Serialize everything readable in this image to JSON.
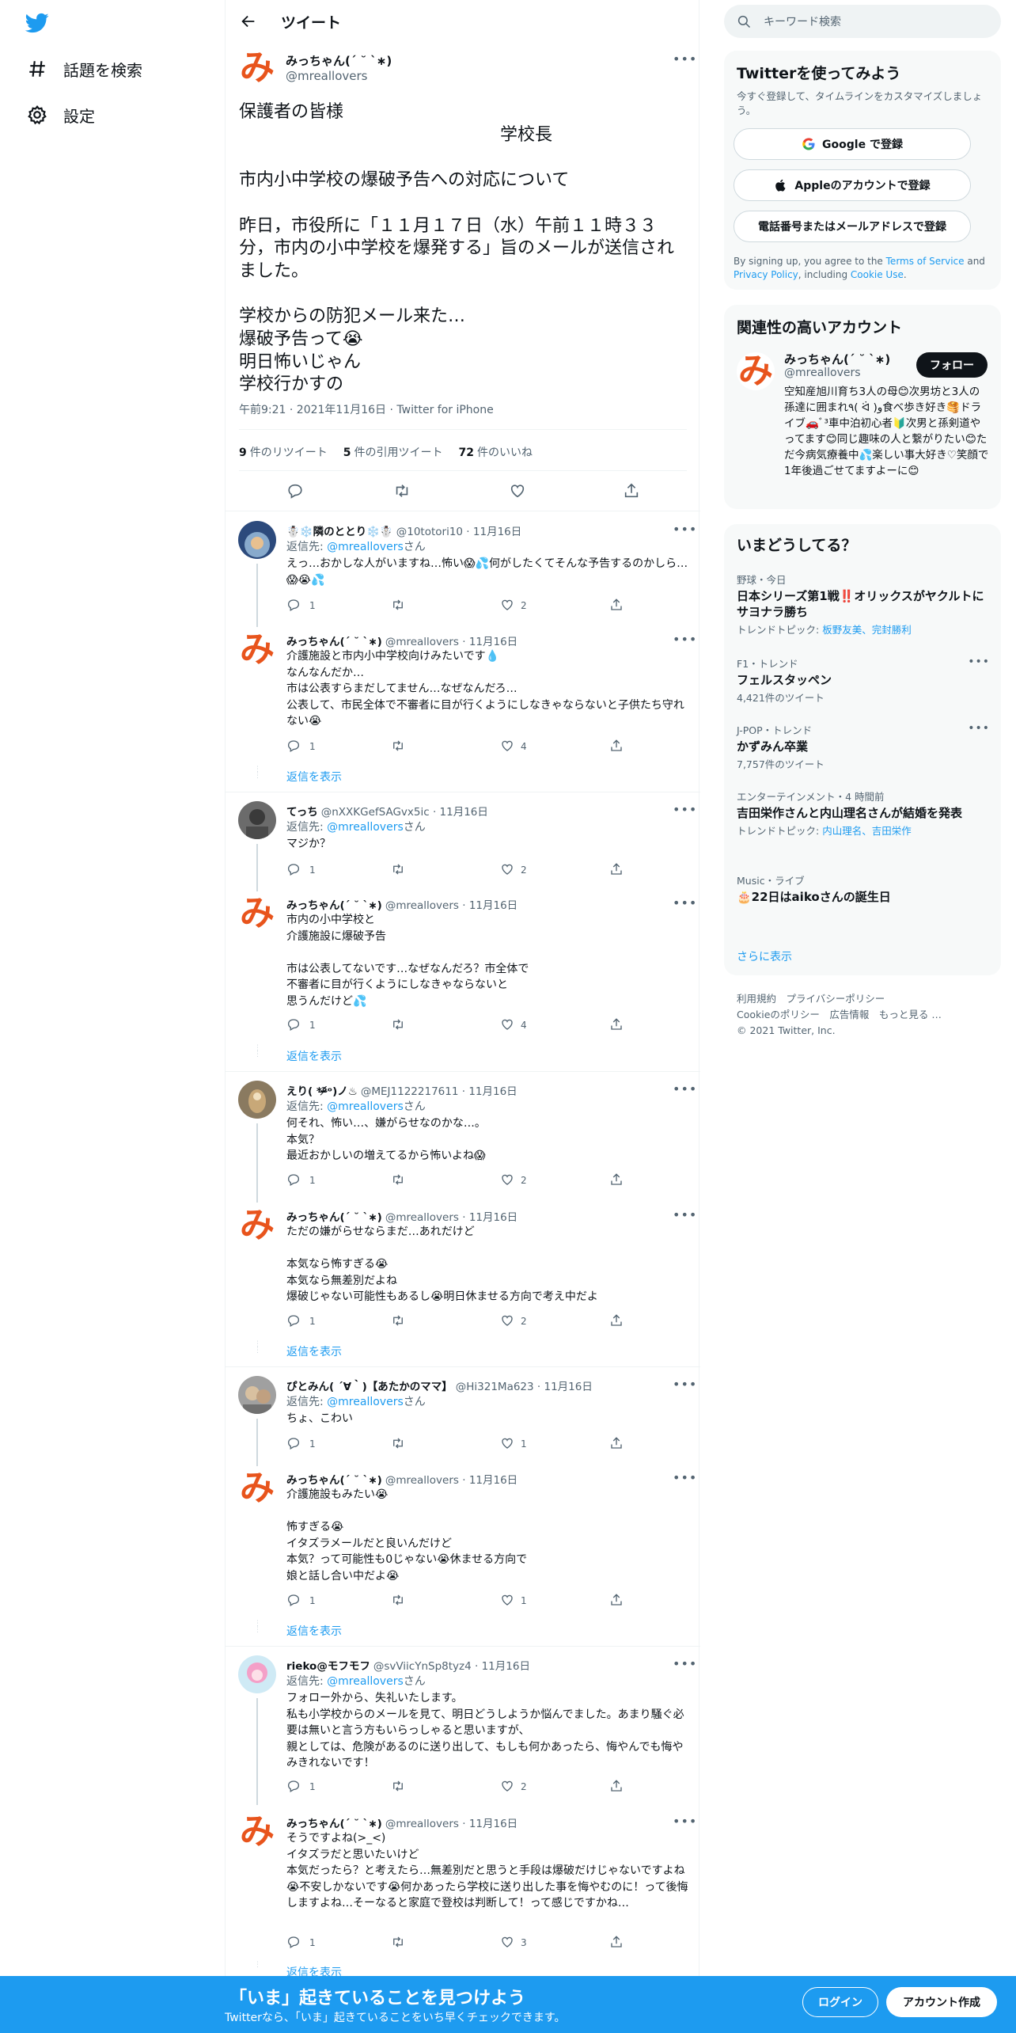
{
  "nav": {
    "explore_label": "話題を検索",
    "settings_label": "設定"
  },
  "header": {
    "title": "ツイート"
  },
  "main_tweet": {
    "name": "みっちゃん(´ ˘ `∗)",
    "handle": "@mreallovers",
    "body": "保護者の皆様\n　　　　　　　　　　　　　　　学校長\n\n市内小中学校の爆破予告への対応について\n\n昨日，市役所に「１１月１７日（水）午前１１時３３分，市内の小中学校を爆発する」旨のメールが送信されました。\n\n学校からの防犯メール来た…\n爆破予告って😭\n明日怖いじゃん\n学校行かすの",
    "meta": "午前9:21 · 2021年11月16日 · Twitter for iPhone",
    "retweets": "9",
    "retweets_label": "件のリツイート",
    "quotes": "5",
    "quotes_label": "件の引用ツイート",
    "likes": "72",
    "likes_label": "件のいいね"
  },
  "replies": [
    {
      "name": "☃️❄️隣のととり❄️☃️",
      "handle": "@10totori10",
      "date": "11月16日",
      "reply_to": "@mreallovers",
      "reply_prefix": "返信先: ",
      "reply_suffix": "さん",
      "body": "えっ…おかしな人がいますね…怖い😱💦何がしたくてそんな予告するのかしら…😱😭💦",
      "replies": "1",
      "rts": "",
      "likes": "2"
    },
    {
      "name": "みっちゃん(´ ˘ `∗)",
      "handle": "@mreallovers",
      "date": "11月16日",
      "body": "介護施設と市内小中学校向けみたいです💧\nなんなんだか…\n市は公表すらまだしてません…なぜなんだろ…\n公表して、市民全体で不審者に目が行くようにしなきゃならないと子供たち守れない😭",
      "replies": "1",
      "rts": "",
      "likes": "4",
      "show_more": "返信を表示"
    },
    {
      "name": "てっち",
      "handle": "@nXXKGefSAGvx5ic",
      "date": "11月16日",
      "reply_to": "@mreallovers",
      "reply_prefix": "返信先: ",
      "reply_suffix": "さん",
      "body": "マジか？",
      "replies": "1",
      "rts": "",
      "likes": "2"
    },
    {
      "name": "みっちゃん(´ ˘ `∗)",
      "handle": "@mreallovers",
      "date": "11月16日",
      "body": "市内の小中学校と\n介護施設に爆破予告\n\n市は公表してないです…なぜなんだろ？市全体で\n不審者に目が行くようにしなきゃならないと\n思うんだけど💦",
      "replies": "1",
      "rts": "",
      "likes": "4",
      "show_more": "返信を表示"
    },
    {
      "name": "えり( *ᵒ̴̶̷᷄ᵒ)ノ♨",
      "handle": "@MEJ1122217611",
      "date": "11月16日",
      "reply_to": "@mreallovers",
      "reply_prefix": "返信先: ",
      "reply_suffix": "さん",
      "body": "何それ、怖い…、嫌がらせなのかな…。\n本気？\n最近おかしいの増えてるから怖いよね😱",
      "replies": "1",
      "rts": "",
      "likes": "2"
    },
    {
      "name": "みっちゃん(´ ˘ `∗)",
      "handle": "@mreallovers",
      "date": "11月16日",
      "body": "ただの嫌がらせならまだ…あれだけど\n\n本気なら怖すぎる😭\n本気なら無差別だよね\n爆破じゃない可能性もあるし😭明日休ませる方向で考え中だよ",
      "replies": "1",
      "rts": "",
      "likes": "2",
      "show_more": "返信を表示"
    },
    {
      "name": "ぴとみん( ´∀｀)【あたかのママ】",
      "handle": "@Hi321Ma623",
      "date": "11月16日",
      "reply_to": "@mreallovers",
      "reply_prefix": "返信先: ",
      "reply_suffix": "さん",
      "body": "ちょ、こわい",
      "replies": "1",
      "rts": "",
      "likes": "1"
    },
    {
      "name": "みっちゃん(´ ˘ `∗)",
      "handle": "@mreallovers",
      "date": "11月16日",
      "body": "介護施設もみたい😭\n\n怖すぎる😭\nイタズラメールだと良いんだけど\n本気？って可能性も0じゃない😭休ませる方向で\n娘と話し合い中だよ😭",
      "replies": "1",
      "rts": "",
      "likes": "1",
      "show_more": "返信を表示"
    },
    {
      "name": "rieko@モフモフ",
      "handle": "@svViicYnSp8tyz4",
      "date": "11月16日",
      "reply_to": "@mreallovers",
      "reply_prefix": "返信先: ",
      "reply_suffix": "さん",
      "body": "フォロー外から、失礼いたします。\n私も小学校からのメールを見て、明日どうしようか悩んでました。あまり騒ぐ必要は無いと言う方もいらっしゃると思いますが、\n親としては、危険があるのに送り出して、もしも何かあったら、悔やんでも悔やみきれないです！",
      "replies": "1",
      "rts": "",
      "likes": "2"
    },
    {
      "name": "みっちゃん(´ ˘ `∗)",
      "handle": "@mreallovers",
      "date": "11月16日",
      "body": "そうですよね(>_<)\nイタズラだと思いたいけど\n本気だったら？と考えたら…無差別だと思うと手段は爆破だけじゃないですよね😭不安しかないです😭何かあったら学校に送り出した事を悔やむのに！って後悔しますよね…そーなると家庭で登校は判断して！って感じですかね…",
      "replies": "1",
      "rts": "",
      "likes": "3",
      "show_more": "返信を表示"
    }
  ],
  "right": {
    "search_placeholder": "キーワード検索",
    "signup": {
      "title": "Twitterを使ってみよう",
      "subtitle": "今すぐ登録して、タイムラインをカスタマイズしましょう。",
      "google": "Google で登録",
      "apple": "Appleのアカウントで登録",
      "phone": "電話番号またはメールアドレスで登録",
      "terms_1": "By signing up, you agree to the ",
      "terms_link1": "Terms of Service",
      "terms_2": " and ",
      "terms_link2": "Privacy Policy",
      "terms_3": ", including ",
      "terms_link3": "Cookie Use",
      "terms_4": "."
    },
    "related": {
      "title": "関連性の高いアカウント",
      "name": "みっちゃん(´ ˘ `∗)",
      "handle": "@mreallovers",
      "follow": "フォロー",
      "bio": "空知産旭川育ち3人の母😊次男坊と3人の孫達に囲まれ٩( ᐛ )و食べ歩き好き🥞ドライブ🚗ﾞ³車中泊初心者🔰次男と孫剣道やってます😊同じ趣味の人と繋がりたい😊ただ今病気療養中💦楽しい事大好き♡笑顔で1年後過ごせてますよーに😊"
    },
    "trends": {
      "title": "いまどうしてる？",
      "items": [
        {
          "meta": "野球・今日",
          "title": "日本シリーズ第1戦‼️オリックスがヤクルトにサヨナラ勝ち",
          "sub_prefix": "トレンドトピック: ",
          "sub_links": "板野友美、完封勝利"
        },
        {
          "meta": "F1・トレンド",
          "title": "フェルスタッペン",
          "sub": "4,421件のツイート"
        },
        {
          "meta": "J-POP・トレンド",
          "title": "かずみん卒業",
          "sub": "7,757件のツイート"
        },
        {
          "meta": "エンターテインメント・4 時間前",
          "title": "吉田栄作さんと内山理名さんが結婚を発表",
          "sub_prefix": "トレンドトピック: ",
          "sub_links": "内山理名、吉田栄作"
        },
        {
          "meta": "Music・ライブ",
          "title": "🎂22日はaikoさんの誕生日"
        }
      ],
      "show_more": "さらに表示"
    },
    "footer": {
      "line1": "利用規約　プライバシーポリシー",
      "line2": "Cookieのポリシー　広告情報　もっと見る …",
      "line3": "© 2021 Twitter, Inc."
    }
  },
  "banner": {
    "title": "「いま」起きていることを見つけよう",
    "subtitle": "Twitterなら、「いま」起きていることをいち早くチェックできます。",
    "login": "ログイン",
    "signup": "アカウント作成"
  }
}
